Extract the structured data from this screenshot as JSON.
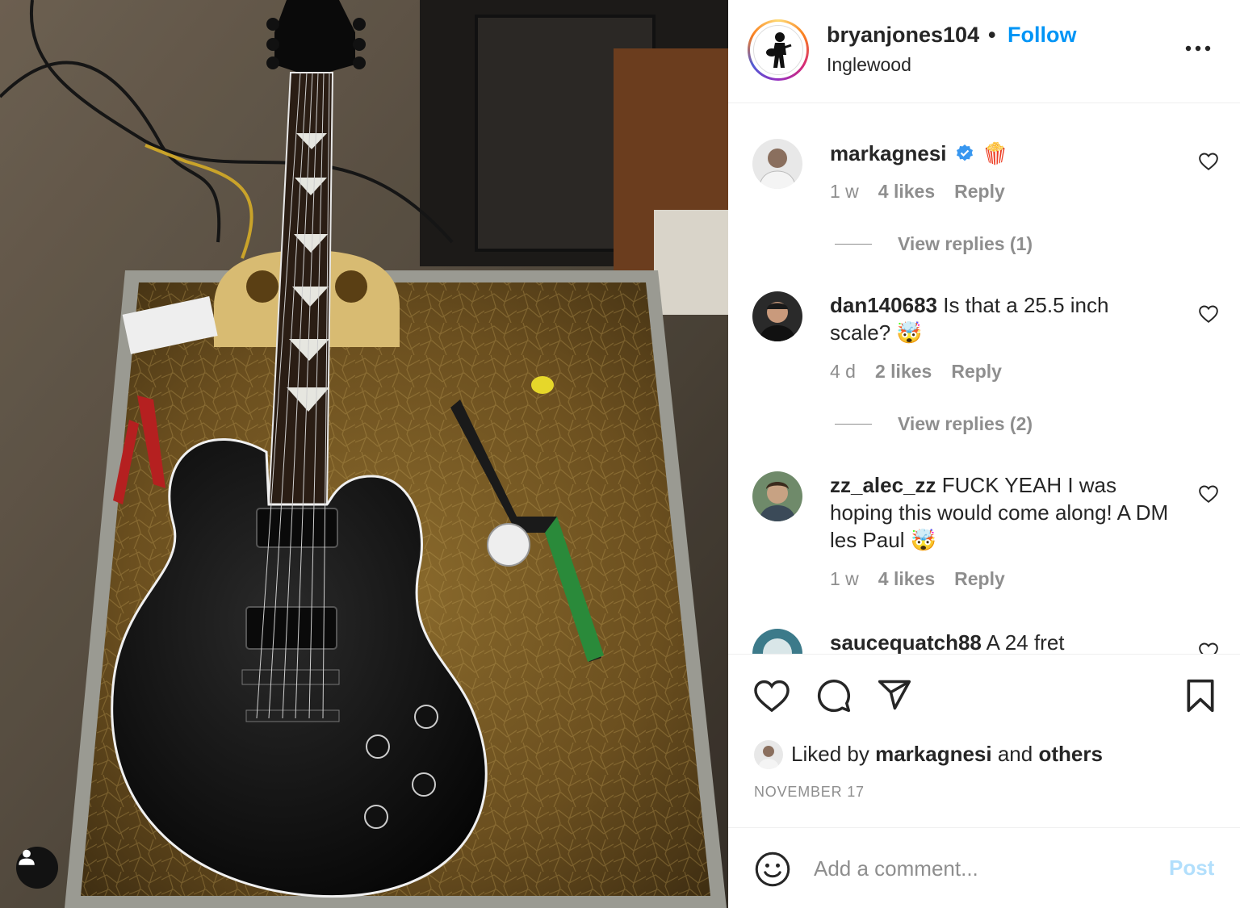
{
  "post": {
    "username": "bryanjones104",
    "separator": "•",
    "follow_label": "Follow",
    "location": "Inglewood"
  },
  "comments": [
    {
      "username": "markagnesi",
      "text": "",
      "time": "1 w",
      "likes": "4 likes",
      "reply_label": "Reply",
      "verified": true,
      "emoji": "🍿",
      "view_replies": "View replies (1)"
    },
    {
      "username": "dan140683",
      "text": "Is that a 25.5 inch scale? 🤯",
      "time": "4 d",
      "likes": "2 likes",
      "reply_label": "Reply",
      "view_replies": "View replies (2)"
    },
    {
      "username": "zz_alec_zz",
      "text": "FUCK YEAH I was hoping this would come along! A DM les Paul 🤯",
      "time": "1 w",
      "likes": "4 likes",
      "reply_label": "Reply"
    },
    {
      "username": "saucequatch88",
      "text": "A 24 fret"
    }
  ],
  "liked_by": {
    "prefix": "Liked by",
    "user": "markagnesi",
    "conjunction": "and",
    "others": "others"
  },
  "date": "NOVEMBER 17",
  "add_comment": {
    "placeholder": "Add a comment...",
    "post_label": "Post"
  },
  "colors": {
    "follow": "#0095f6",
    "muted": "#8e8e8e",
    "post_disabled": "#b2dffc",
    "verified": "#3897f0"
  },
  "icons": [
    "user-tag-icon",
    "more-options-icon",
    "verified-badge-icon",
    "heart-icon",
    "comment-icon",
    "share-icon",
    "bookmark-icon",
    "emoji-icon"
  ]
}
